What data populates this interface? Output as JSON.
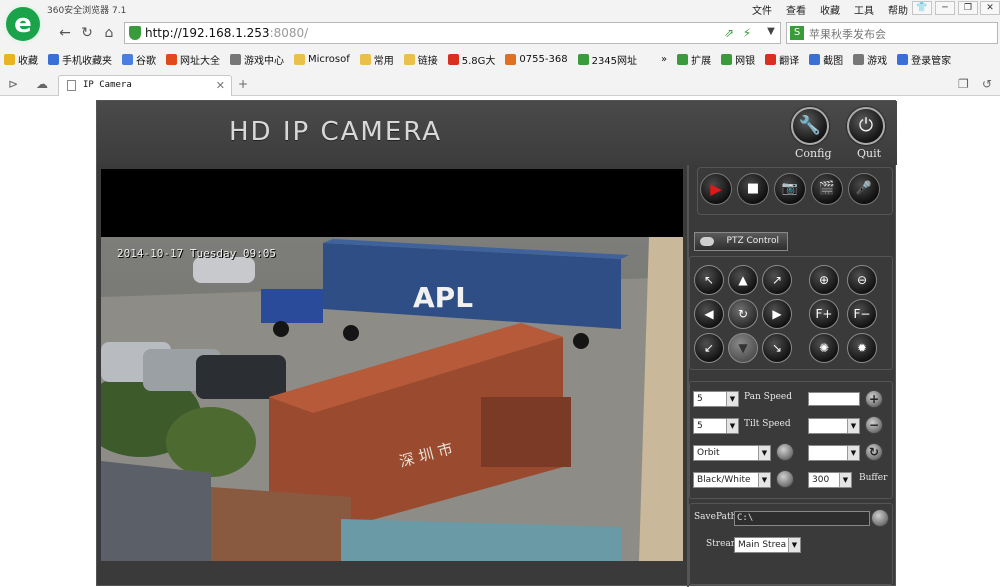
{
  "browser": {
    "window_title": "360安全浏览器 7.1",
    "menu": [
      "文件",
      "查看",
      "收藏",
      "工具",
      "帮助"
    ],
    "address": {
      "host": "http://192.168.1.253",
      "rest": ":8080/"
    },
    "search_placeholder": "苹果秋季发布会",
    "bookmarks": [
      {
        "label": "收藏",
        "color": "#e9b321"
      },
      {
        "label": "手机收藏夹",
        "color": "#3b6fd8"
      },
      {
        "label": "谷歌",
        "color": "#4a7ee0"
      },
      {
        "label": "网址大全",
        "color": "#e04a1a"
      },
      {
        "label": "游戏中心",
        "color": "#777777"
      },
      {
        "label": "Microsof",
        "color": "#e8c04a"
      },
      {
        "label": "常用",
        "color": "#e8c04a"
      },
      {
        "label": "链接",
        "color": "#e8c04a"
      },
      {
        "label": "5.8G大",
        "color": "#d83020"
      },
      {
        "label": "0755-368",
        "color": "#e07020"
      },
      {
        "label": "2345网址",
        "color": "#3a9b3a"
      },
      {
        "label": "»",
        "color": "transparent"
      },
      {
        "label": "扩展",
        "color": "#3a9b3a"
      },
      {
        "label": "网银",
        "color": "#3a9b3a"
      },
      {
        "label": "翻译",
        "color": "#d83020"
      },
      {
        "label": "截图",
        "color": "#3a6fd8"
      },
      {
        "label": "游戏",
        "color": "#777777"
      },
      {
        "label": "登录管家",
        "color": "#3a6fd8"
      }
    ],
    "tab_title": "IP Camera"
  },
  "camera": {
    "title": "HD IP CAMERA",
    "config_label": "Config",
    "quit_label": "Quit",
    "osd_text": "2014-10-17 Tuesday 09:05",
    "ptz_label": "PTZ Control",
    "pan_speed_value": "5",
    "pan_speed_label": "Pan Speed",
    "tilt_speed_value": "5",
    "tilt_speed_label": "Tilt Speed",
    "orbit_value": "Orbit",
    "color_mode_value": "Black/White",
    "buffer_value": "300",
    "buffer_label": "Buffer",
    "savepath_label": "SavePath",
    "savepath_value": "C:\\",
    "stream_label": "Stream",
    "stream_value": "Main Strea",
    "accent_record": "#e01818"
  }
}
